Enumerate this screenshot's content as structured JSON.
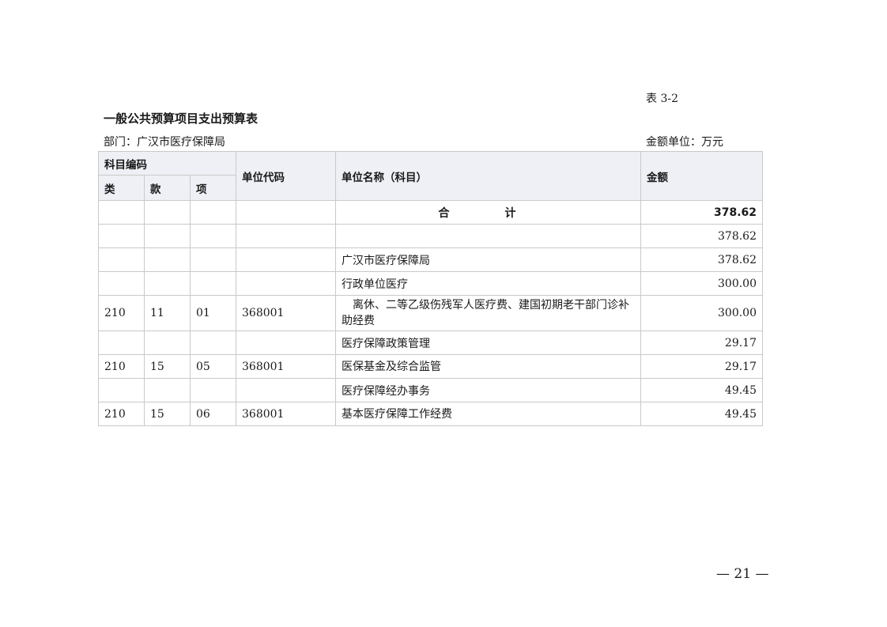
{
  "header": {
    "table_no": "表 3-2",
    "title": "一般公共预算项目支出预算表",
    "department": "部门：广汉市医疗保障局",
    "unit": "金额单位：万元"
  },
  "columns": {
    "subject_code": "科目编码",
    "lei": "类",
    "kuan": "款",
    "xiang": "项",
    "unit_code": "单位代码",
    "unit_name": "单位名称（科目）",
    "amount": "金额"
  },
  "rows": [
    {
      "lei": "",
      "kuan": "",
      "xiang": "",
      "code": "",
      "name": "合　计",
      "amount": "378.62"
    },
    {
      "lei": "",
      "kuan": "",
      "xiang": "",
      "code": "",
      "name": "",
      "amount": "378.62"
    },
    {
      "lei": "",
      "kuan": "",
      "xiang": "",
      "code": "",
      "name": "广汉市医疗保障局",
      "amount": "378.62"
    },
    {
      "lei": "",
      "kuan": "",
      "xiang": "",
      "code": "",
      "name": "行政单位医疗",
      "amount": "300.00"
    },
    {
      "lei": "210",
      "kuan": "11",
      "xiang": "01",
      "code": "368001",
      "name": "离休、二等乙级伤残军人医疗费、建国初期老干部门诊补助经费",
      "amount": "300.00"
    },
    {
      "lei": "",
      "kuan": "",
      "xiang": "",
      "code": "",
      "name": "医疗保障政策管理",
      "amount": "29.17"
    },
    {
      "lei": "210",
      "kuan": "15",
      "xiang": "05",
      "code": "368001",
      "name": "医保基金及综合监管",
      "amount": "29.17"
    },
    {
      "lei": "",
      "kuan": "",
      "xiang": "",
      "code": "",
      "name": "医疗保障经办事务",
      "amount": "49.45"
    },
    {
      "lei": "210",
      "kuan": "15",
      "xiang": "06",
      "code": "368001",
      "name": "基本医疗保障工作经费",
      "amount": "49.45"
    }
  ],
  "footer": {
    "page_number": "— 21 —"
  }
}
